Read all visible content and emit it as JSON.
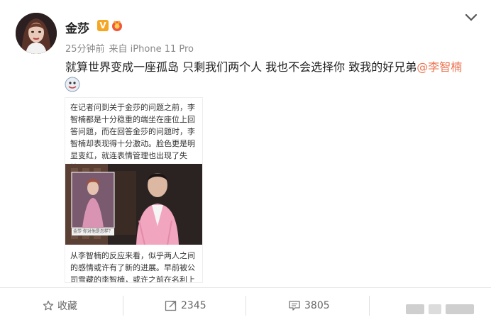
{
  "post": {
    "username": "金莎",
    "vip_badge": "V",
    "time": "25分钟前",
    "source": "来自 iPhone 11 Pro",
    "text": "就算世界变成一座孤岛 只剩我们两个人 我也不会选择你  致我的好兄弟",
    "mention": "@李智楠"
  },
  "card": {
    "paragraph1": "在记者问到关于金莎的问题之前，李智楠都是十分稳重的端坐在座位上回答问题，而在回答金莎的问题时，李智楠却表现得十分激动。脸色更是明显变红，就连表情管理也出现了失控。",
    "inset_caption": "金莎·你对他是怎样？",
    "paragraph2": "从李智楠的反应来看，似乎两人之间的感情或许有了新的进展。早前被公司雪藏的李智楠，或许之前在名利上确实配"
  },
  "actions": {
    "favorite_label": "收藏",
    "repost_count": "2345",
    "comment_count": "3805"
  },
  "colors": {
    "mention": "#eb7350",
    "vip": "#f5a623"
  },
  "icons": [
    "chevron-down-icon",
    "star-icon",
    "repost-icon",
    "comment-icon",
    "medal-icon",
    "emoji-icon"
  ]
}
